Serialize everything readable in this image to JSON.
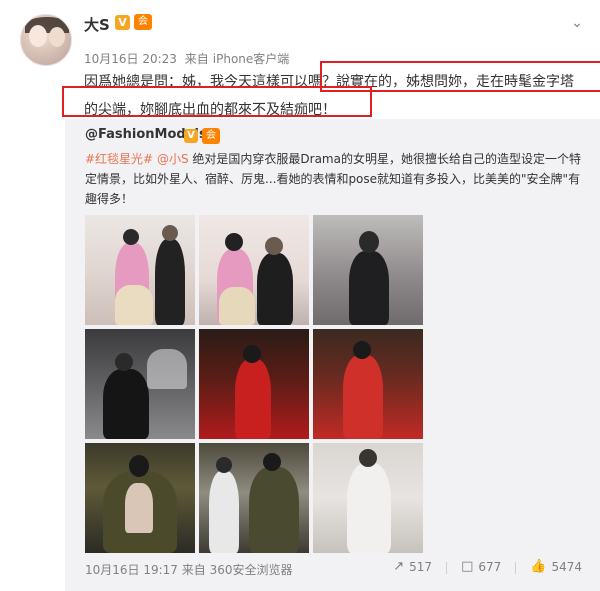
{
  "post": {
    "username": "大S",
    "v_badge": "V",
    "vip_badge": "会",
    "timestamp": "10月16日 20:23",
    "source_prefix": "来自",
    "source": "iPhone客户端",
    "text_line1": "因爲她總是問：姊，我今天這樣可以嗎？說實在的，姊想問妳，走在時髦金字塔",
    "text_line2": "的尖端，妳腳底出血的都來不及結痂吧！"
  },
  "repost": {
    "author": "@FashionModels",
    "v_badge": "V",
    "vip_badge": "会",
    "tag": "#红毯星光#",
    "mention": "@小S",
    "text": " 绝对是国内穿衣服最Drama的女明星，她很擅长给自己的造型设定一个特定情景，比如外星人、宿醉、厉鬼...看她的表情和pose就知道有多投入，比美美的\"安全牌\"有趣得多！",
    "timestamp": "10月16日 19:17",
    "source_prefix": "来自",
    "source": "360安全浏览器",
    "share_count": "517",
    "comment_count": "677",
    "like_count": "5474"
  },
  "icons": {
    "chevron": "chevron-down-icon",
    "share": "share-icon",
    "comment": "comment-icon",
    "like": "like-icon"
  },
  "colors": {
    "link": "#eb7350",
    "annotation": "#e02020",
    "badge_v": "#f5a623",
    "badge_vip": "#ff8200"
  }
}
